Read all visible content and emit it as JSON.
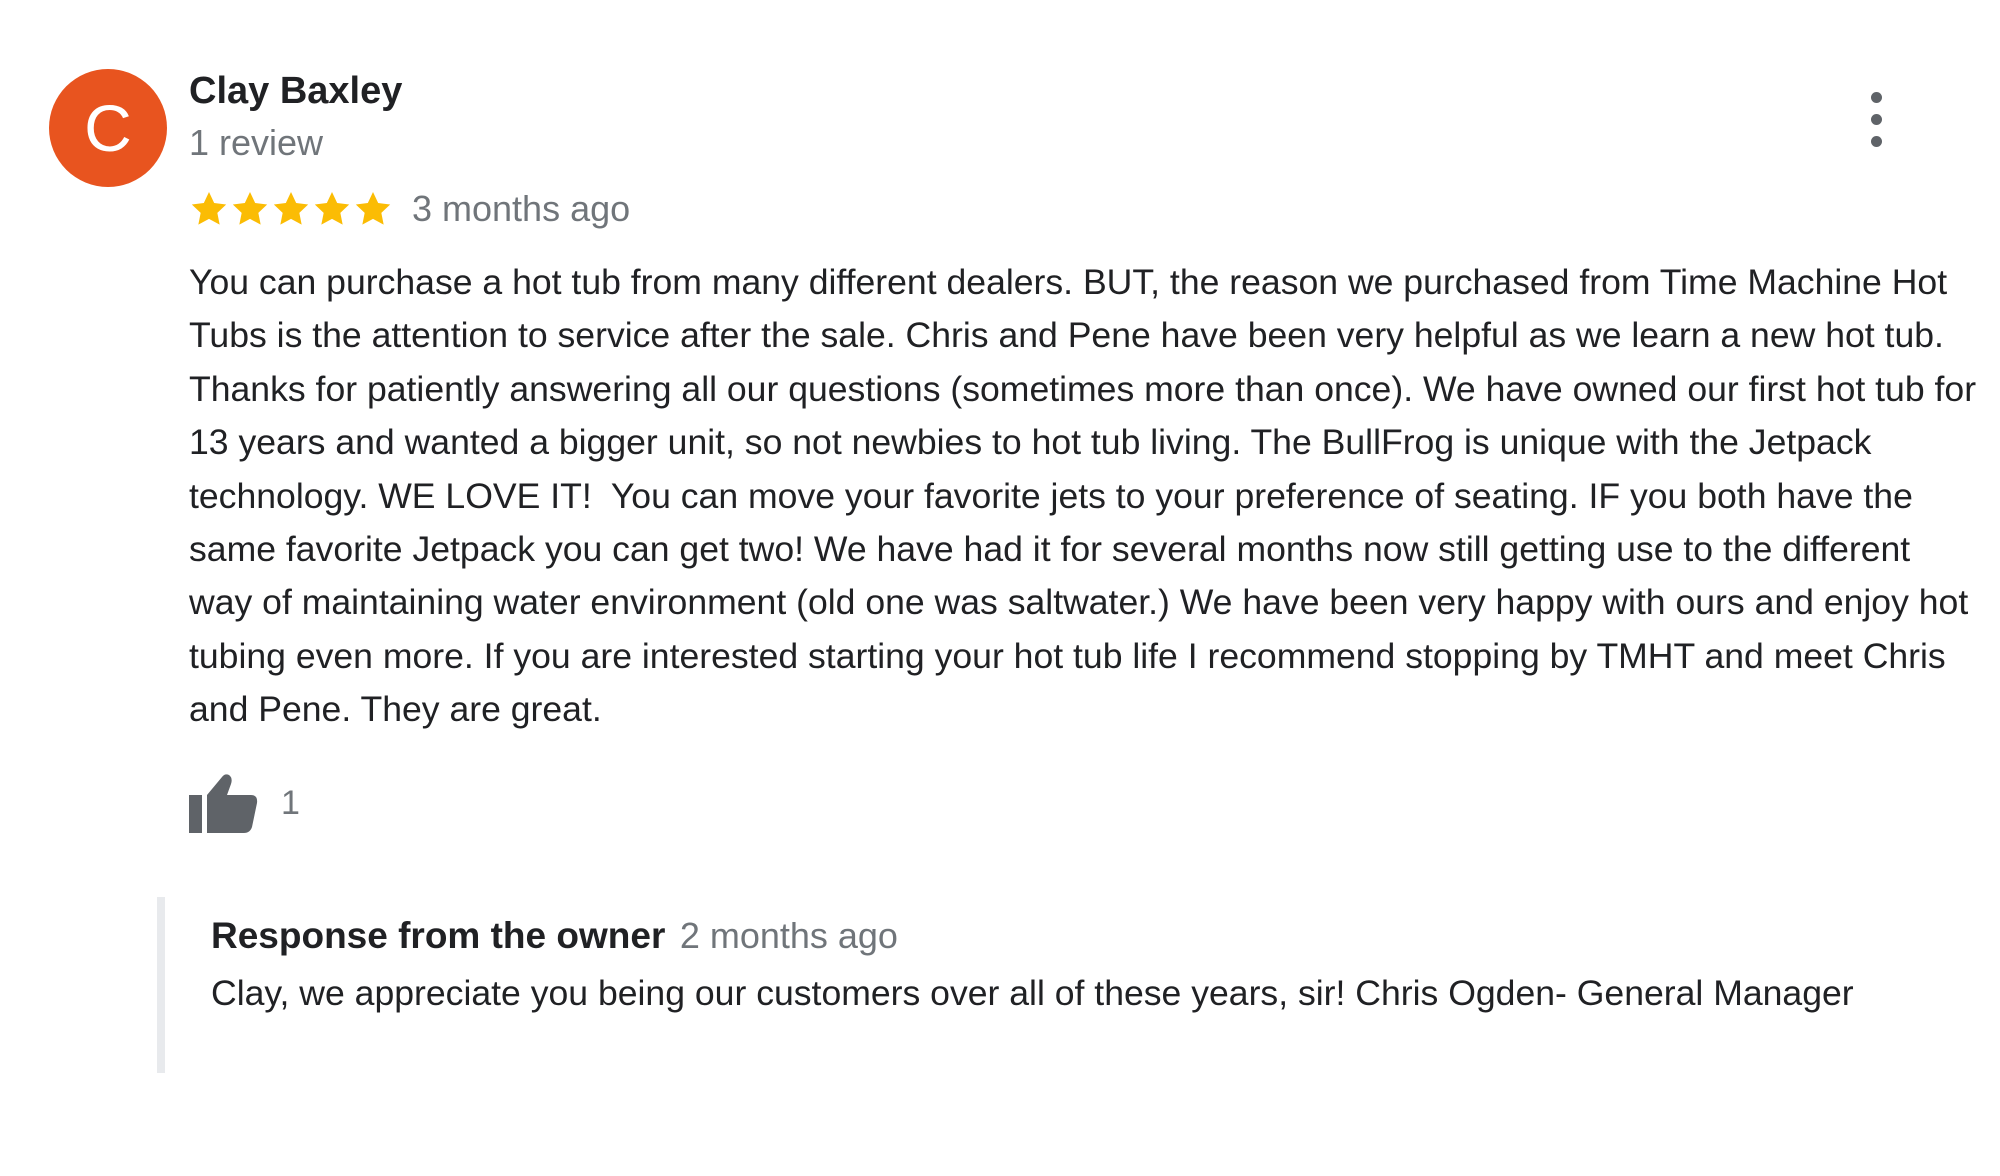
{
  "reviewer": {
    "avatar_letter": "C",
    "avatar_color": "#e8541f",
    "name": "Clay Baxley",
    "review_count": "1 review"
  },
  "more_menu": {
    "icon": "more-vert-icon"
  },
  "review": {
    "rating": 5,
    "rating_max": 5,
    "star_color": "#fbbc04",
    "date": "3 months ago",
    "text": "You can purchase a hot tub from many different dealers. BUT, the reason we purchased from Time Machine Hot Tubs is the attention to service after the sale. Chris and Pene have been very helpful as we learn a new hot tub. Thanks for patiently answering all our questions (sometimes more than once). We have owned our first hot tub for 13 years and wanted a bigger unit, so not newbies to hot tub living. The BullFrog is unique with the Jetpack technology. WE LOVE IT!  You can move your favorite jets to your preference of seating. IF you both have the same favorite Jetpack you can get two! We have had it for several months now still getting use to the different way of maintaining water environment (old one was saltwater.) We have been very happy with ours and enjoy hot tubing even more. If you are interested starting your hot tub life I recommend stopping by TMHT and meet Chris and Pene. They are great.",
    "likes": "1",
    "like_icon": "thumbs-up-icon"
  },
  "owner_response": {
    "title": "Response from the owner",
    "date": "2 months ago",
    "text": "Clay, we appreciate you being our customers over all of these years, sir! Chris Ogden- General Manager"
  }
}
